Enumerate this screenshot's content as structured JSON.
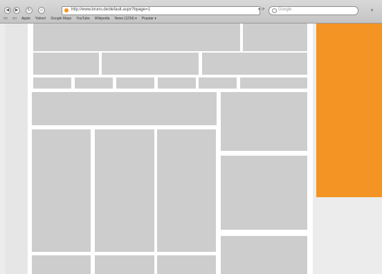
{
  "browser": {
    "nav_buttons": [
      "◀",
      "▶",
      "↻",
      "⌂"
    ],
    "url": "http://www.bruno.de/default.aspx?bpage=1",
    "url_go": "▾ ⟳",
    "search_placeholder": "Google",
    "add_label": "+",
    "bookmarks": [
      "□□",
      "□□",
      "Apple",
      "Yahoo!",
      "Google Maps",
      "YouTube",
      "Wikipedia",
      "News (1234) ▾",
      "Popular ▾"
    ]
  },
  "colors": {
    "accent": "#f39424",
    "block": "#cdcdcd",
    "background": "#ececec"
  }
}
